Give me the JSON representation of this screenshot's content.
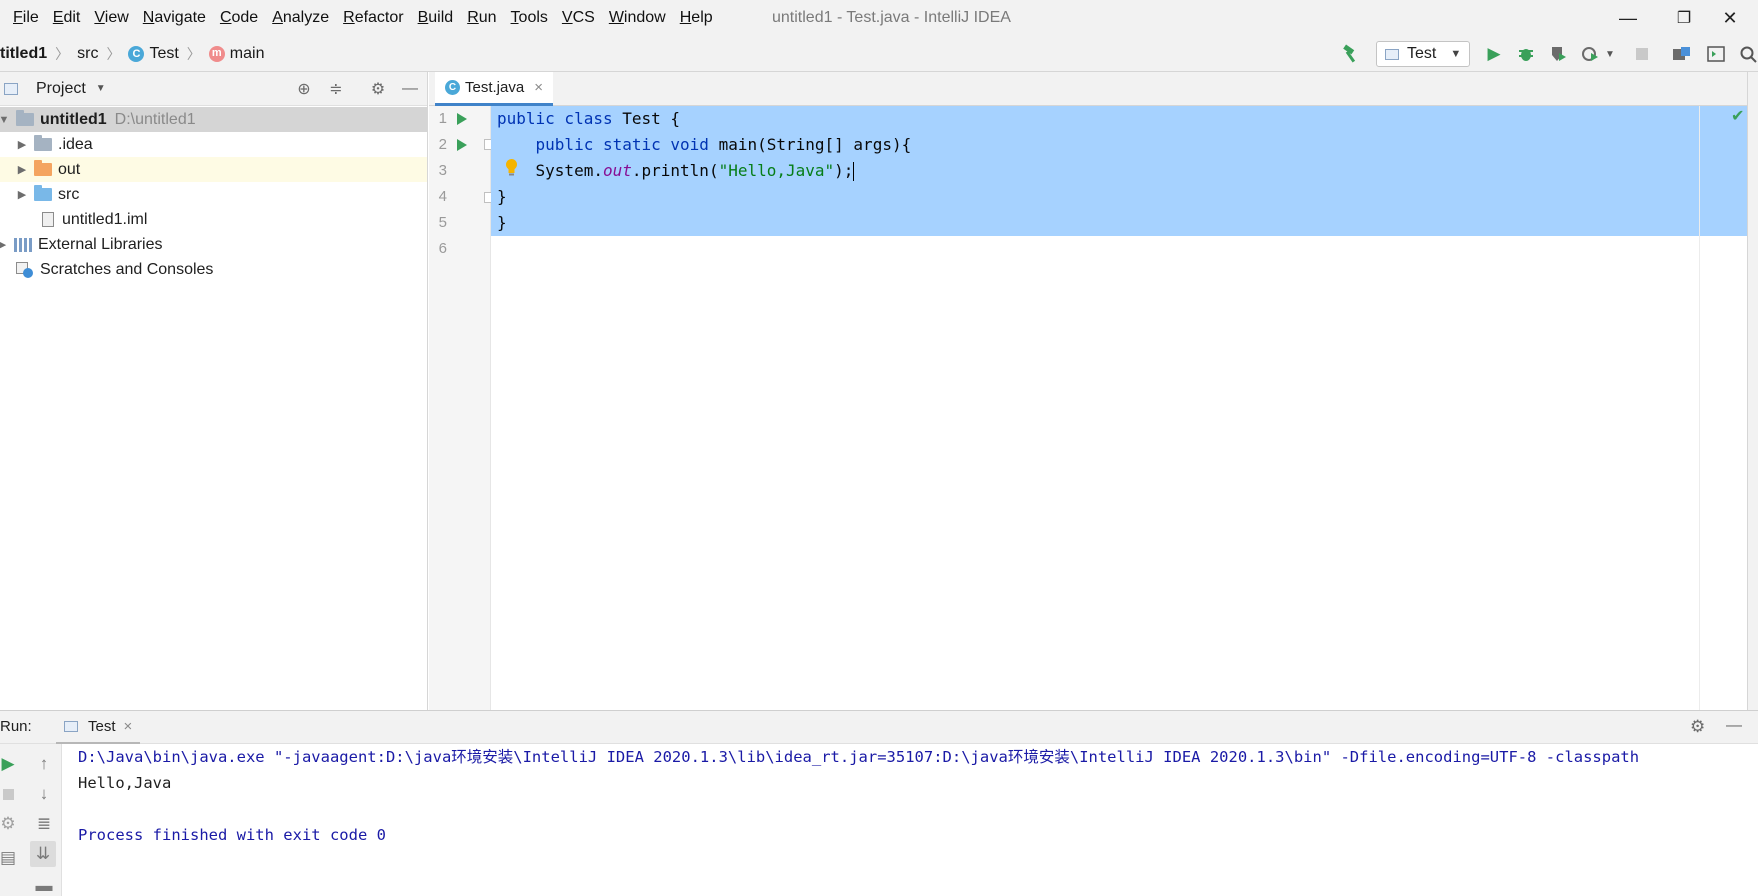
{
  "window": {
    "title": "untitled1 - Test.java - IntelliJ IDEA",
    "minimize": "—",
    "restore": "❐",
    "close": "✕"
  },
  "menu": [
    "File",
    "Edit",
    "View",
    "Navigate",
    "Code",
    "Analyze",
    "Refactor",
    "Build",
    "Run",
    "Tools",
    "VCS",
    "Window",
    "Help"
  ],
  "breadcrumbs": {
    "project": "titled1",
    "folder": "src",
    "class_icon": "C",
    "class": "Test",
    "method_icon": "m",
    "method": "main"
  },
  "toolbar": {
    "run_config": "Test",
    "icons": [
      "hammer-icon",
      "run-icon",
      "debug-icon",
      "coverage-icon",
      "profile-icon",
      "stop-icon",
      "project-structure-icon",
      "terminal-icon",
      "search-icon"
    ]
  },
  "project_panel": {
    "title": "Project",
    "tree": {
      "root": {
        "label": "untitled1",
        "path": "D:\\untitled1"
      },
      "idea": ".idea",
      "out": "out",
      "src": "src",
      "iml": "untitled1.iml",
      "external": "External Libraries",
      "scratches": "Scratches and Consoles"
    }
  },
  "editor": {
    "tab_label": "Test.java",
    "tab_close": "×",
    "line_numbers": [
      "1",
      "2",
      "3",
      "4",
      "5",
      "6"
    ],
    "code": {
      "l1_kw": "public class ",
      "l1_rest": "Test {",
      "l2_indent": "    ",
      "l2_kw": "public static void ",
      "l2_rest": "main(String[] args){",
      "l3_indent": "    ",
      "l3_a": "System.",
      "l3_field": "out",
      "l3_b": ".println(",
      "l3_str": "\"Hello,Java\"",
      "l3_c": ");",
      "l4": "}",
      "l5": "}"
    }
  },
  "run_panel": {
    "label": "Run:",
    "tab": "Test",
    "tab_close": "×",
    "console": {
      "command": "D:\\Java\\bin\\java.exe \"-javaagent:D:\\java环境安装\\IntelliJ IDEA 2020.1.3\\lib\\idea_rt.jar=35107:D:\\java环境安装\\IntelliJ IDEA 2020.1.3\\bin\" -Dfile.encoding=UTF-8 -classpath",
      "output": "Hello,Java",
      "finished": "Process finished with exit code 0"
    }
  },
  "colors": {
    "selection": "#a6d2ff",
    "keyword": "#0033b3",
    "string": "#067d17",
    "field": "#871094",
    "run_green": "#3aa05a",
    "console_blue": "#1a1aa6",
    "folder_gray": "#a5b3c2",
    "folder_orange": "#f4a460",
    "folder_blue": "#79b8e8"
  }
}
